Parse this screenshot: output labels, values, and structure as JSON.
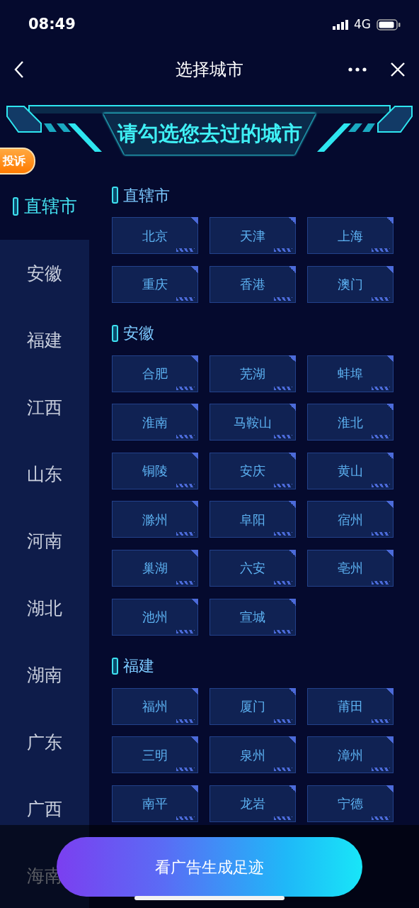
{
  "status_bar": {
    "time": "08:49",
    "network": "4G"
  },
  "nav_bar": {
    "title": "选择城市"
  },
  "banner": {
    "title": "请勾选您去过的城市"
  },
  "complaint_badge": {
    "label": "投诉"
  },
  "sidebar": {
    "items": [
      {
        "label": "直辖市",
        "selected": true
      },
      {
        "label": "安徽",
        "selected": false
      },
      {
        "label": "福建",
        "selected": false
      },
      {
        "label": "江西",
        "selected": false
      },
      {
        "label": "山东",
        "selected": false
      },
      {
        "label": "河南",
        "selected": false
      },
      {
        "label": "湖北",
        "selected": false
      },
      {
        "label": "湖南",
        "selected": false
      },
      {
        "label": "广东",
        "selected": false
      },
      {
        "label": "广西",
        "selected": false
      },
      {
        "label": "海南",
        "selected": false
      }
    ]
  },
  "sections": [
    {
      "title": "直辖市",
      "cities": [
        "北京",
        "天津",
        "上海",
        "重庆",
        "香港",
        "澳门"
      ]
    },
    {
      "title": "安徽",
      "cities": [
        "合肥",
        "芜湖",
        "蚌埠",
        "淮南",
        "马鞍山",
        "淮北",
        "铜陵",
        "安庆",
        "黄山",
        "滁州",
        "阜阳",
        "宿州",
        "巢湖",
        "六安",
        "亳州",
        "池州",
        "宣城"
      ]
    },
    {
      "title": "福建",
      "cities": [
        "福州",
        "厦门",
        "莆田",
        "三明",
        "泉州",
        "漳州",
        "南平",
        "龙岩",
        "宁德"
      ]
    }
  ],
  "action_button": {
    "label": "看广告生成足迹"
  }
}
